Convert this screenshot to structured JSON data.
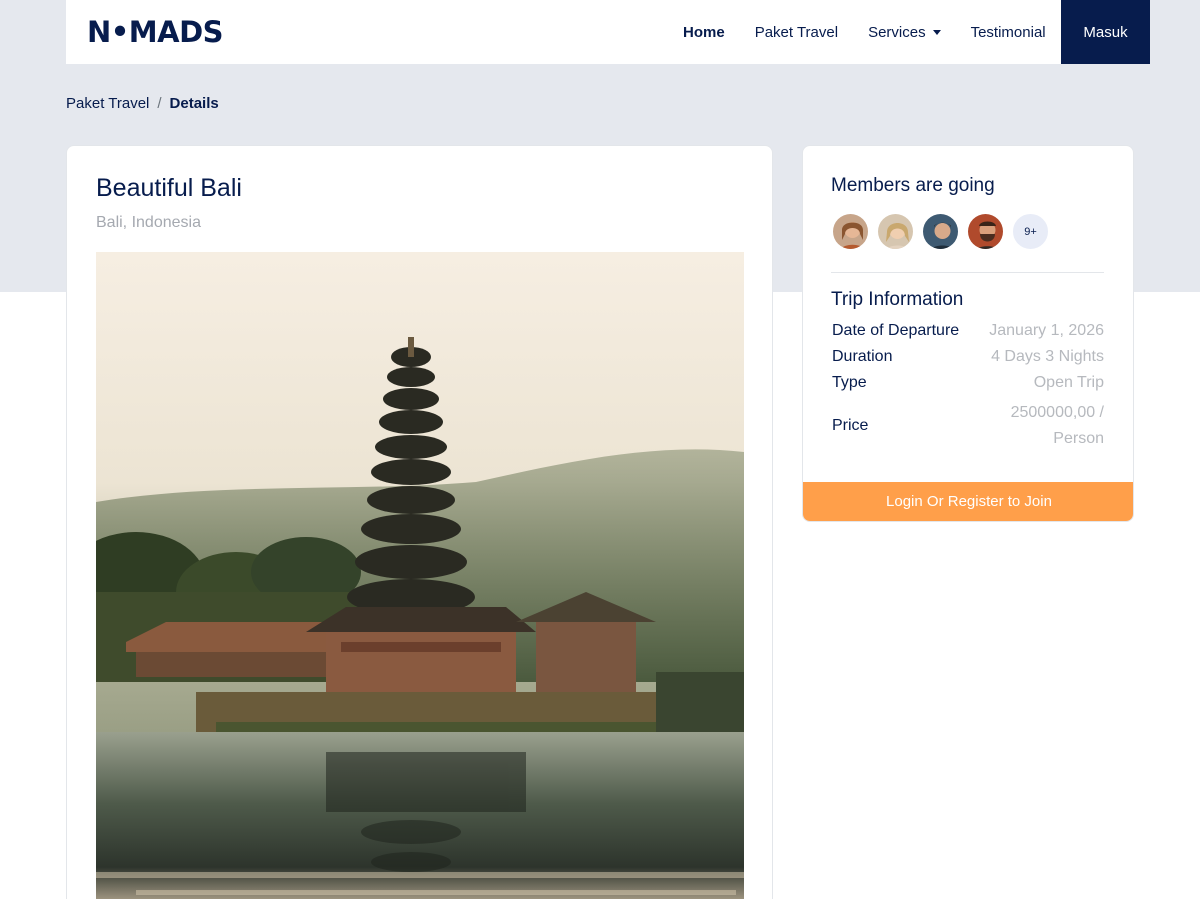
{
  "brand": {
    "logo_text": "N•MADS"
  },
  "nav": {
    "links": [
      {
        "label": "Home"
      },
      {
        "label": "Paket Travel"
      },
      {
        "label": "Services"
      },
      {
        "label": "Testimonial"
      }
    ],
    "login_label": "Masuk"
  },
  "breadcrumb": {
    "parent": "Paket Travel",
    "separator": "/",
    "current": "Details"
  },
  "trip": {
    "title": "Beautiful Bali",
    "location": "Bali, Indonesia"
  },
  "members": {
    "title": "Members are going",
    "more_label": "9+"
  },
  "trip_info": {
    "title": "Trip Information",
    "rows": [
      {
        "label": "Date of Departure",
        "value": "January 1, 2026"
      },
      {
        "label": "Duration",
        "value": "4 Days 3 Nights"
      },
      {
        "label": "Type",
        "value": "Open Trip"
      },
      {
        "label": "Price",
        "value": "2500000,00 / Person"
      }
    ]
  },
  "join_label": "Login Or Register to Join",
  "colors": {
    "primary": "#071c4d",
    "accent": "#ff9f4a",
    "muted": "#b6b9be",
    "band": "#e5e8ee"
  }
}
